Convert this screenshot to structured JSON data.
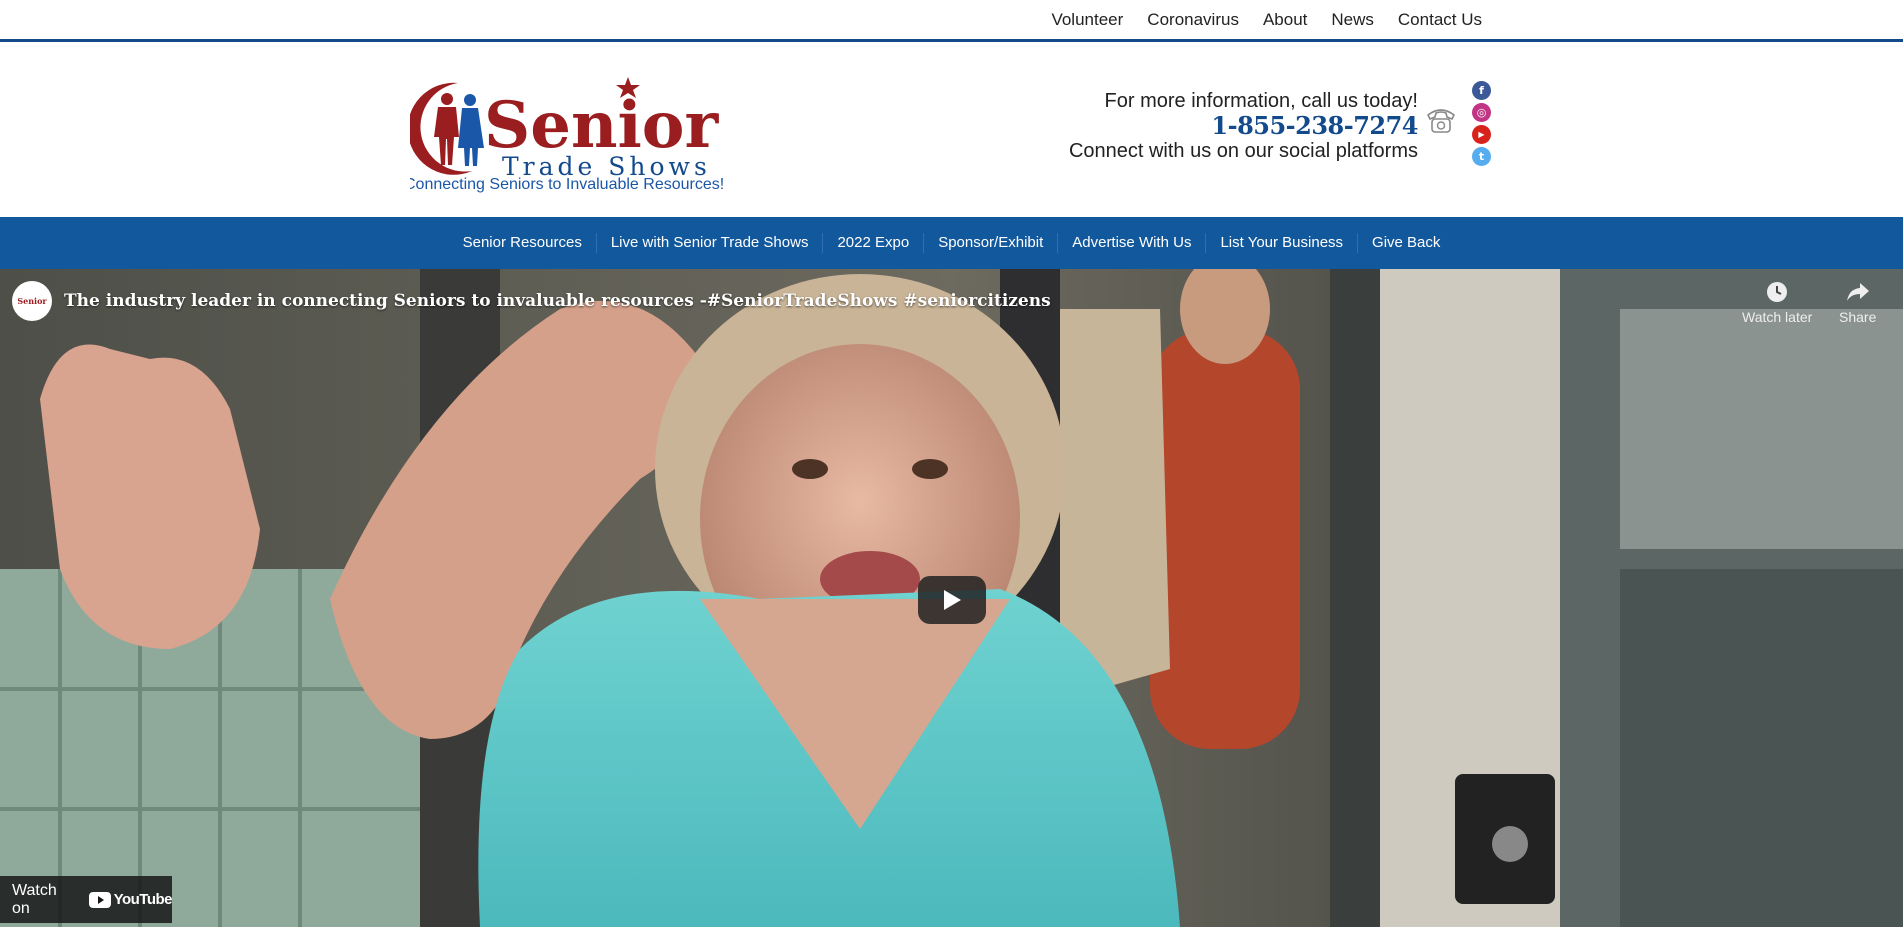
{
  "topnav": {
    "items": [
      "Volunteer",
      "Coronavirus",
      "About",
      "News",
      "Contact Us"
    ]
  },
  "header": {
    "logo_text": "Senior",
    "logo_subtext": "Trade Shows",
    "tagline": "Connecting Seniors to Invaluable Resources!  Connecting Senic",
    "info_line": "For more information, call us today!",
    "phone": "1-855-238-7274",
    "social_line": "Connect with us on our social platforms",
    "socials": [
      {
        "name": "facebook-icon",
        "glyph": "f",
        "color": "#3b5998"
      },
      {
        "name": "instagram-icon",
        "glyph": "◎",
        "color": "#c13584"
      },
      {
        "name": "youtube-icon",
        "glyph": "▶",
        "color": "#d8231c"
      },
      {
        "name": "twitter-icon",
        "glyph": "t",
        "color": "#55acee"
      }
    ],
    "colors": {
      "brand_red": "#9a1d20",
      "brand_blue": "#134a8c"
    }
  },
  "mainnav": {
    "items": [
      "Senior Resources",
      "Live with Senior Trade Shows",
      "2022 Expo",
      "Sponsor/Exhibit",
      "Advertise With Us",
      "List Your Business",
      "Give Back"
    ],
    "background": "#12589d"
  },
  "video": {
    "channel_badge": "Senior",
    "title": "The industry leader in connecting Seniors to invaluable resources -#SeniorTradeShows #seniorcitizens",
    "watch_later": "Watch later",
    "share": "Share",
    "watch_on": "Watch on",
    "youtube": "YouTube"
  }
}
